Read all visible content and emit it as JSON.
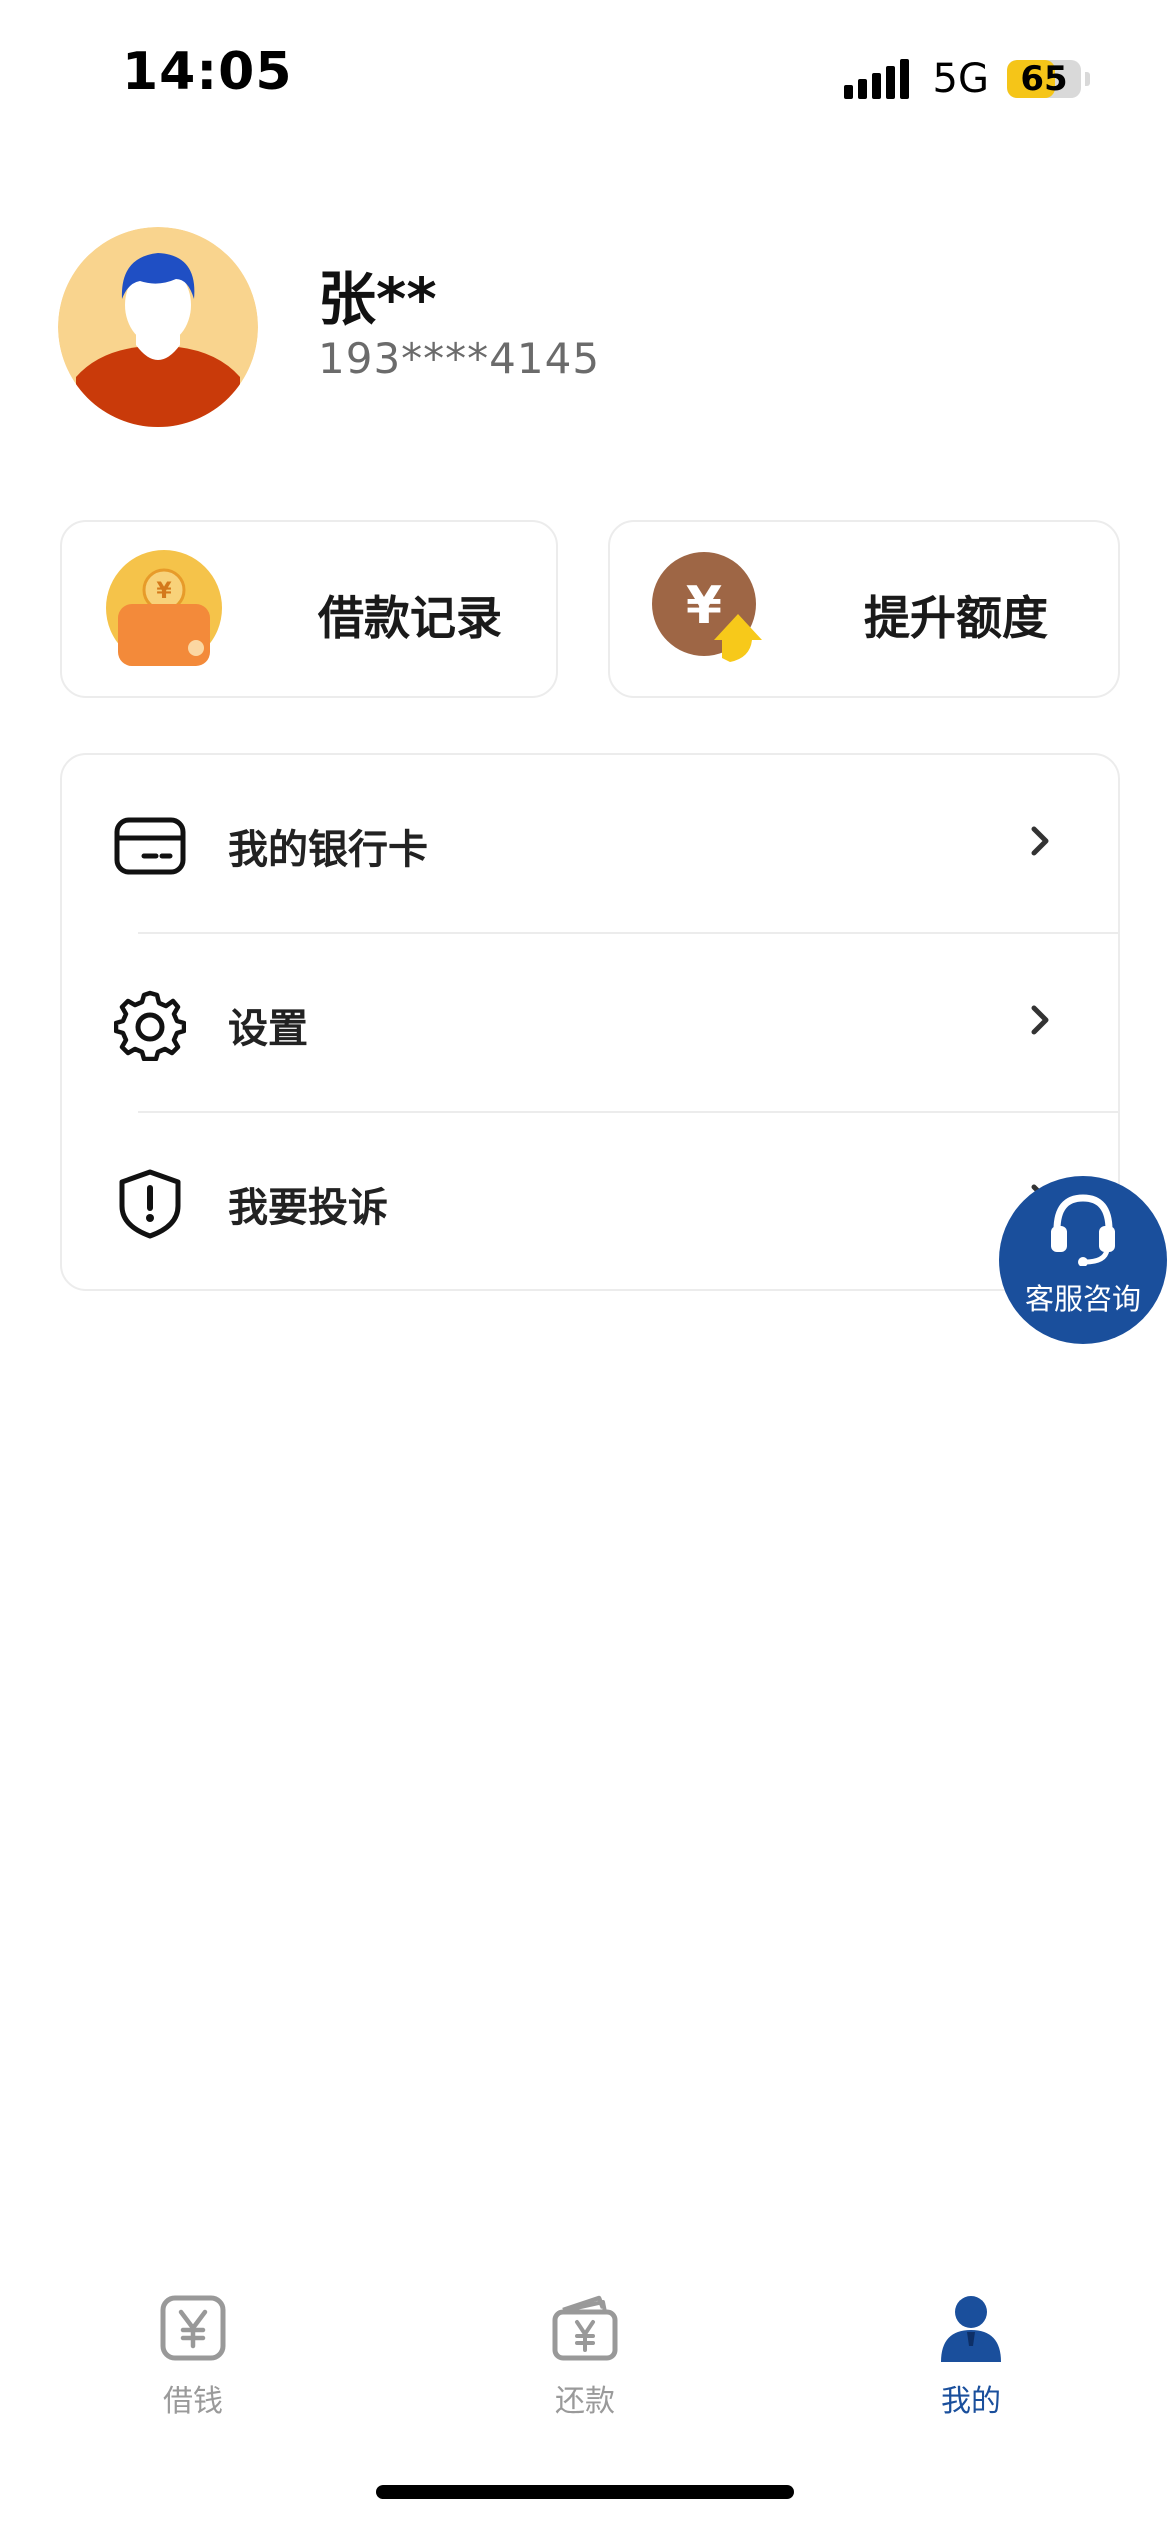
{
  "status_bar": {
    "time": "14:05",
    "network": "5G",
    "battery": "65",
    "battery_level": 0.65
  },
  "profile": {
    "name": "张**",
    "phone": "193****4145"
  },
  "quick_actions": [
    {
      "label": "借款记录",
      "icon": "wallet-coin-icon"
    },
    {
      "label": "提升额度",
      "icon": "yen-up-arrow-icon"
    }
  ],
  "menu": [
    {
      "label": "我的银行卡",
      "icon": "bank-card-icon"
    },
    {
      "label": "设置",
      "icon": "gear-icon"
    },
    {
      "label": "我要投诉",
      "icon": "shield-alert-icon"
    }
  ],
  "floating_service": {
    "label": "客服咨询",
    "icon": "headset-icon"
  },
  "tab_bar": [
    {
      "label": "借钱",
      "icon": "yen-square-icon",
      "active": false
    },
    {
      "label": "还款",
      "icon": "yen-wallet-icon",
      "active": false
    },
    {
      "label": "我的",
      "icon": "person-icon",
      "active": true
    }
  ],
  "colors": {
    "accent": "#1a4f9c",
    "battery": "#f5c518",
    "inactive_tab": "#9a9a9a",
    "avatar_bg": "#f9d48e",
    "avatar_shirt": "#c93a0a",
    "avatar_hair": "#1f4fc4",
    "coin_brown": "#9e6645"
  }
}
